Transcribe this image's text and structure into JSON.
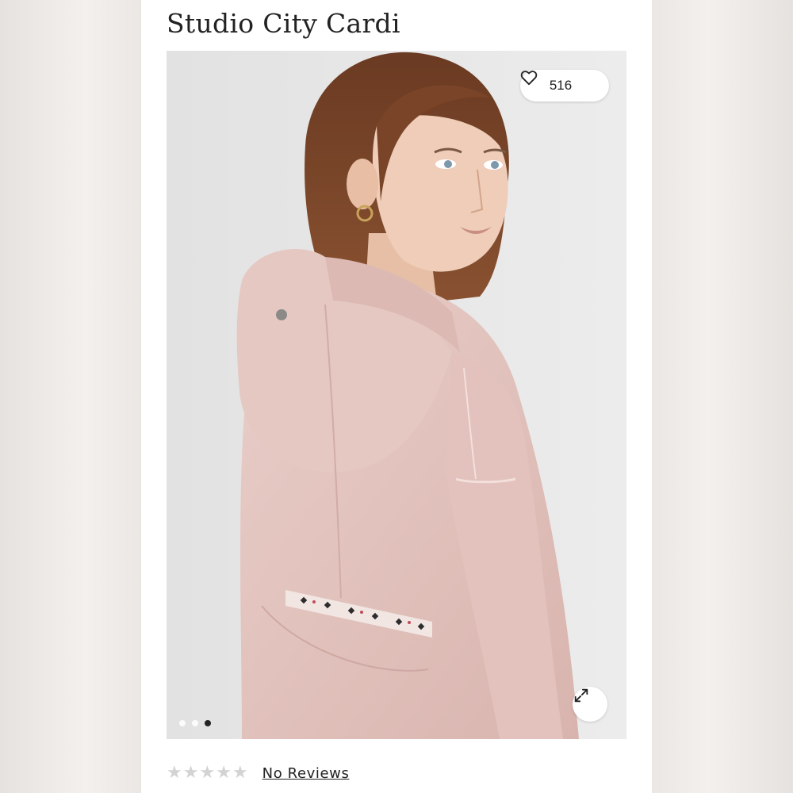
{
  "product": {
    "title": "Studio City Cardi",
    "likes": "516",
    "image_alt": "Model wearing a pink hooded cardigan, back view"
  },
  "gallery": {
    "total_slides": 3,
    "active_slide": 3
  },
  "rating": {
    "stars_filled": 0,
    "stars_total": 5,
    "reviews_label": "No Reviews"
  },
  "icons": {
    "heart": "heart-icon",
    "expand": "expand-icon",
    "star": "star-icon"
  },
  "colors": {
    "garment": "#e3c4bf",
    "background": "#e6e6e6",
    "star_empty": "#d3d3d3",
    "text": "#222222"
  }
}
